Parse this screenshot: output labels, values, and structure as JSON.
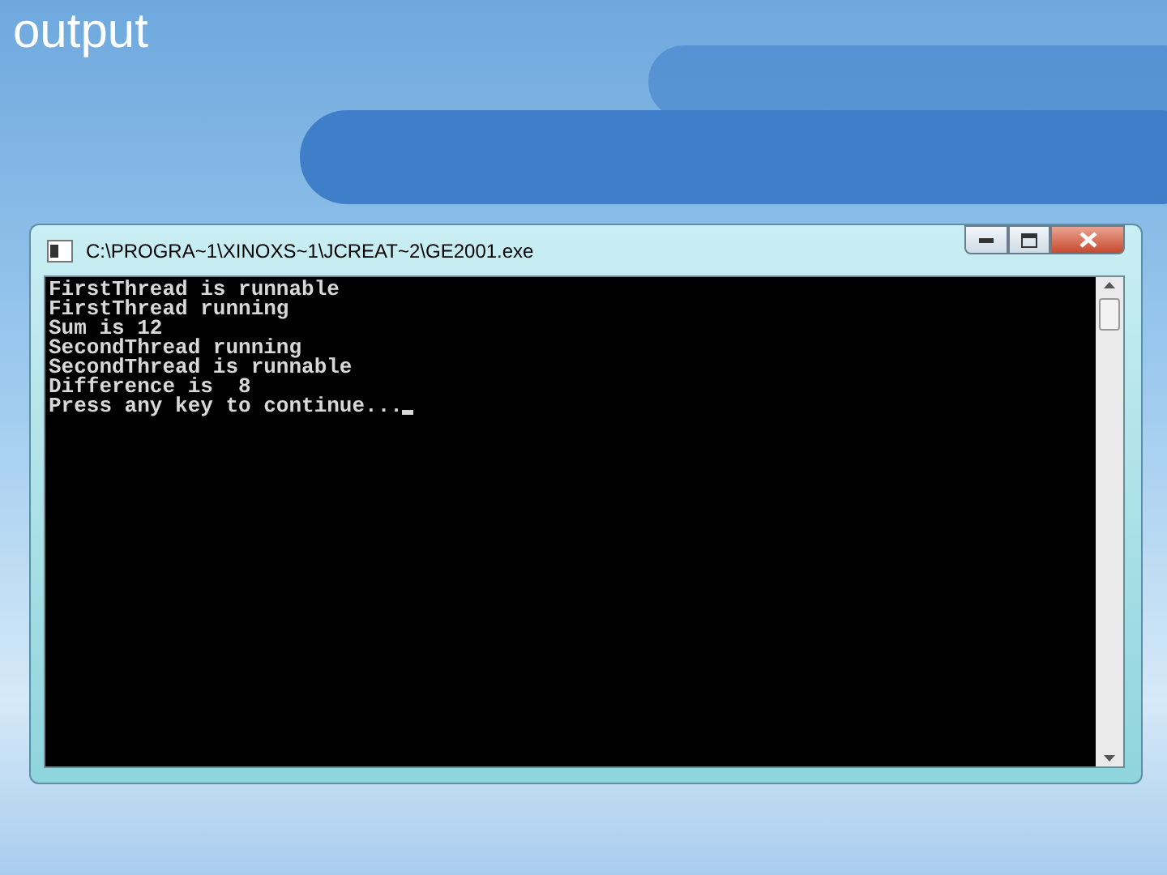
{
  "slide": {
    "title": "output"
  },
  "window": {
    "title": "C:\\PROGRA~1\\XINOXS~1\\JCREAT~2\\GE2001.exe"
  },
  "console": {
    "lines": [
      "FirstThread is runnable",
      "FirstThread running",
      "Sum is 12",
      "SecondThread running",
      "SecondThread is runnable",
      "Difference is  8",
      "Press any key to continue..."
    ],
    "cursor": true
  }
}
